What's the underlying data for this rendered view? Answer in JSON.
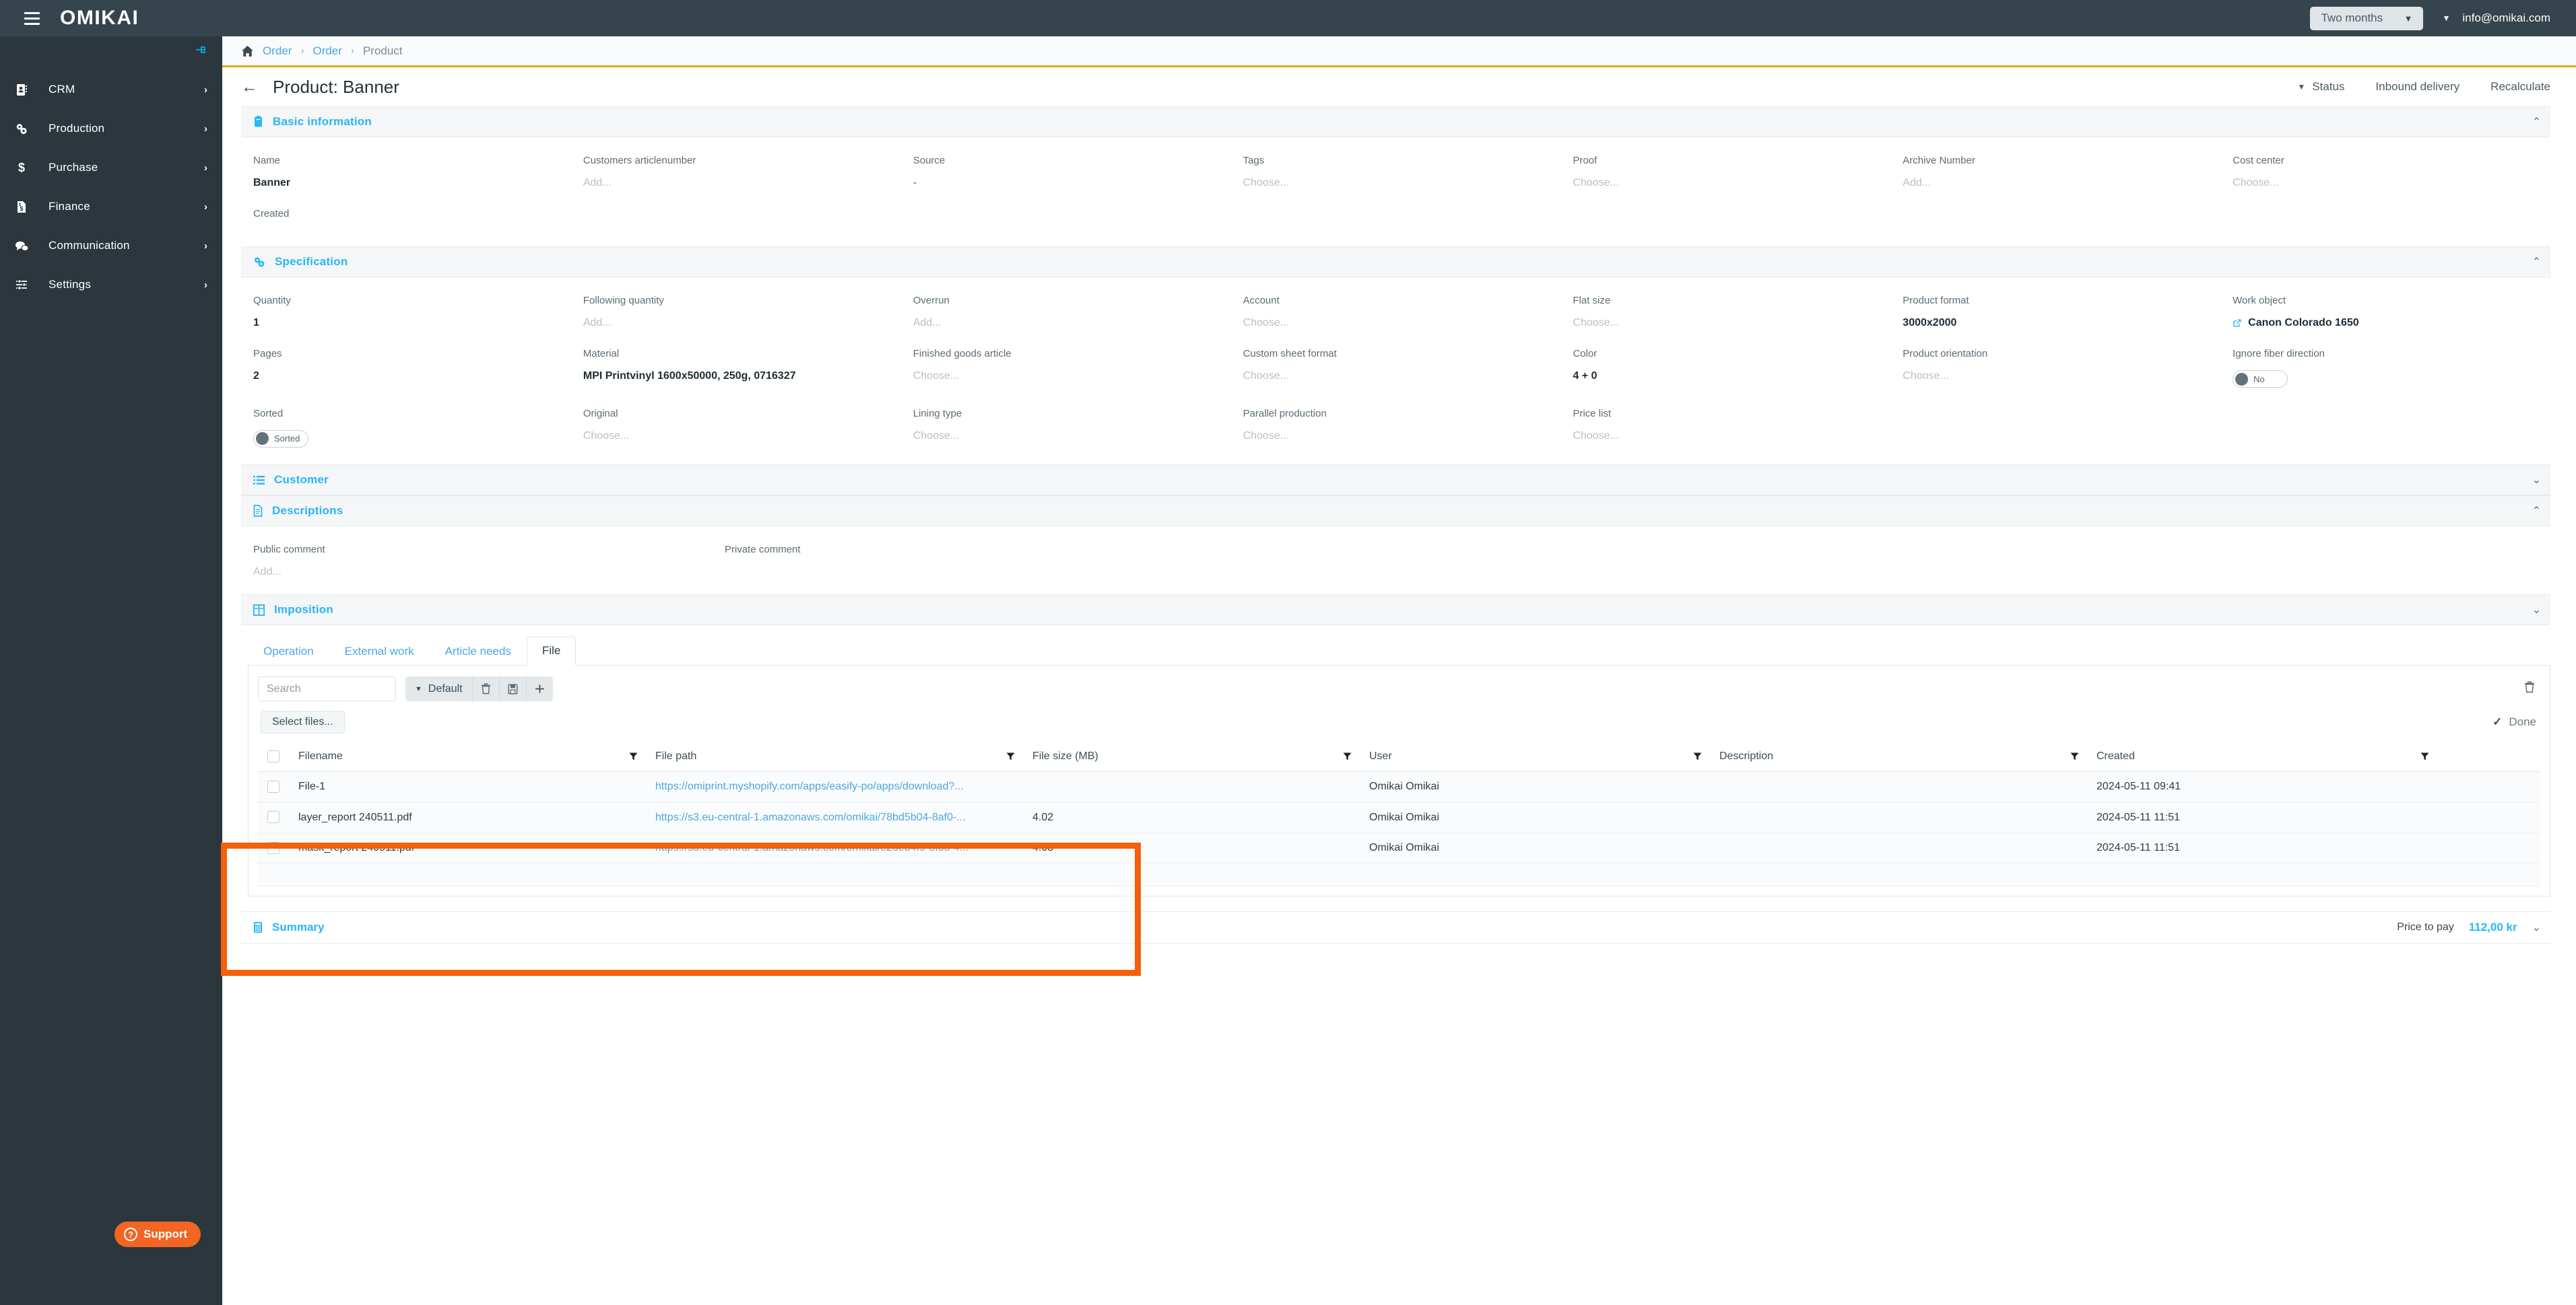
{
  "brand": {
    "name": "OMIKAI",
    "menu_icon": "hamburger-icon",
    "pin_icon": "pin-icon"
  },
  "sidebar": {
    "items": [
      {
        "label": "CRM",
        "icon": "contacts-icon",
        "chevron": "›"
      },
      {
        "label": "Production",
        "icon": "gears-icon",
        "chevron": "›"
      },
      {
        "label": "Purchase",
        "icon": "dollar-icon",
        "chevron": "›"
      },
      {
        "label": "Finance",
        "icon": "invoice-icon",
        "chevron": "›"
      },
      {
        "label": "Communication",
        "icon": "chat-icon",
        "chevron": "›"
      },
      {
        "label": "Settings",
        "icon": "sliders-icon",
        "chevron": "›"
      }
    ],
    "support_label": "Support",
    "support_icon": "question-circle-icon",
    "support_color": "#f26522"
  },
  "topbar": {
    "period_value": "Two months",
    "period_caret": "▼",
    "user_caret": "▼",
    "user_email": "info@omikai.com"
  },
  "breadcrumb": {
    "home_icon": "home-icon",
    "items": [
      {
        "label": "Order",
        "current": false
      },
      {
        "label": "Order",
        "current": false
      },
      {
        "label": "Product",
        "current": true
      }
    ],
    "separator": "›",
    "accent_color": "#f0a30a"
  },
  "page": {
    "back_icon": "arrow-left-icon",
    "title": "Product: Banner",
    "actions": [
      {
        "label": "Status",
        "caret": "▼"
      },
      {
        "label": "Inbound delivery",
        "caret": ""
      },
      {
        "label": "Recalculate",
        "caret": ""
      }
    ]
  },
  "sections": {
    "basic_information": {
      "title": "Basic information",
      "icon": "clipboard-icon",
      "toggle": "⌃",
      "rows": [
        [
          {
            "label": "Name",
            "value": "Banner",
            "style": "bold"
          },
          {
            "label": "Customers articlenumber",
            "value": "Add...",
            "style": "placeholder"
          },
          {
            "label": "Source",
            "value": "-",
            "style": "plain"
          },
          {
            "label": "Tags",
            "value": "Choose...",
            "style": "placeholder"
          },
          {
            "label": "Proof",
            "value": "Choose...",
            "style": "placeholder"
          },
          {
            "label": "Archive Number",
            "value": "Add...",
            "style": "placeholder"
          },
          {
            "label": "Cost center",
            "value": "Choose...",
            "style": "placeholder"
          }
        ],
        [
          {
            "label": "Created",
            "value": "",
            "style": "plain"
          },
          {
            "label": "",
            "value": "",
            "style": "plain"
          },
          {
            "label": "",
            "value": "",
            "style": "plain"
          },
          {
            "label": "",
            "value": "",
            "style": "plain"
          },
          {
            "label": "",
            "value": "",
            "style": "plain"
          },
          {
            "label": "",
            "value": "",
            "style": "plain"
          },
          {
            "label": "",
            "value": "",
            "style": "plain"
          }
        ]
      ]
    },
    "specification": {
      "title": "Specification",
      "icon": "gears-icon",
      "toggle": "⌃",
      "rows": [
        [
          {
            "label": "Quantity",
            "value": "1",
            "style": "bold"
          },
          {
            "label": "Following quantity",
            "value": "Add...",
            "style": "placeholder"
          },
          {
            "label": "Overrun",
            "value": "Add...",
            "style": "placeholder"
          },
          {
            "label": "Account",
            "value": "Choose...",
            "style": "placeholder"
          },
          {
            "label": "Flat size",
            "value": "Choose...",
            "style": "placeholder"
          },
          {
            "label": "Product format",
            "value": "3000x2000",
            "style": "bold"
          },
          {
            "label": "Work object",
            "value": "Canon Colorado 1650",
            "style": "link"
          }
        ],
        [
          {
            "label": "Pages",
            "value": "2",
            "style": "bold"
          },
          {
            "label": "Material",
            "value": "MPI Printvinyl 1600x50000, 250g, 0716327",
            "style": "bold"
          },
          {
            "label": "Finished goods article",
            "value": "Choose...",
            "style": "placeholder"
          },
          {
            "label": "Custom sheet format",
            "value": "Choose...",
            "style": "placeholder"
          },
          {
            "label": "Color",
            "value": "4 + 0",
            "style": "bold"
          },
          {
            "label": "Product orientation",
            "value": "Choose...",
            "style": "placeholder"
          },
          {
            "label": "Ignore fiber direction",
            "value": "No",
            "style": "toggle"
          }
        ],
        [
          {
            "label": "Sorted",
            "value": "Sorted",
            "style": "toggle"
          },
          {
            "label": "Original",
            "value": "Choose...",
            "style": "placeholder"
          },
          {
            "label": "Lining type",
            "value": "Choose...",
            "style": "placeholder"
          },
          {
            "label": "Parallel production",
            "value": "Choose...",
            "style": "placeholder"
          },
          {
            "label": "Price list",
            "value": "Choose...",
            "style": "placeholder"
          },
          {
            "label": "",
            "value": "",
            "style": "plain"
          },
          {
            "label": "",
            "value": "",
            "style": "plain"
          }
        ]
      ]
    },
    "customer": {
      "title": "Customer",
      "icon": "list-icon",
      "toggle": "⌄"
    },
    "descriptions": {
      "title": "Descriptions",
      "icon": "document-icon",
      "toggle": "⌃",
      "public_label": "Public comment",
      "public_value": "Add...",
      "private_label": "Private comment",
      "private_value": ""
    },
    "imposition": {
      "title": "Imposition",
      "icon": "grid-icon",
      "toggle": "⌄"
    },
    "summary": {
      "title": "Summary",
      "icon": "calculator-icon",
      "price_label": "Price to pay",
      "price_value": "112,00 kr",
      "toggle": "⌄"
    }
  },
  "tabs": [
    {
      "label": "Operation",
      "active": false
    },
    {
      "label": "External work",
      "active": false
    },
    {
      "label": "Article needs",
      "active": false
    },
    {
      "label": "File",
      "active": true
    }
  ],
  "file_toolbar": {
    "search_placeholder": "Search",
    "search_value": "",
    "view_caret": "▼",
    "view_label": "Default",
    "delete_icon": "trash-icon",
    "save_icon": "save-icon",
    "add_icon": "plus-icon",
    "right_icon": "trash-icon"
  },
  "file_actions": {
    "select_files_label": "Select files...",
    "done_label": "Done",
    "done_icon": "check-icon"
  },
  "file_table": {
    "columns": [
      {
        "label": "Filename",
        "filter": true
      },
      {
        "label": "File path",
        "filter": true
      },
      {
        "label": "File size (MB)",
        "filter": true
      },
      {
        "label": "User",
        "filter": true
      },
      {
        "label": "Description",
        "filter": true
      },
      {
        "label": "Created",
        "filter": true
      }
    ],
    "rows": [
      {
        "filename": "File-1",
        "filepath": "https://omiprint.myshopify.com/apps/easify-po/apps/download?...",
        "filesize": "",
        "user": "Omikai Omikai",
        "description": "",
        "created": "2024-05-11 09:41"
      },
      {
        "filename": "layer_report 240511.pdf",
        "filepath": "https://s3.eu-central-1.amazonaws.com/omikai/78bd5b04-8af0-...",
        "filesize": "4.02",
        "user": "Omikai Omikai",
        "description": "",
        "created": "2024-05-11 11:51"
      },
      {
        "filename": "mask_report 240511.pdf",
        "filepath": "https://s3.eu-central-1.amazonaws.com/omikai/e23e34f9-5f33-4...",
        "filesize": "4.03",
        "user": "Omikai Omikai",
        "description": "",
        "created": "2024-05-11 11:51"
      }
    ]
  },
  "annotation": {
    "color": "#f4600c",
    "shape": "rectangle"
  }
}
